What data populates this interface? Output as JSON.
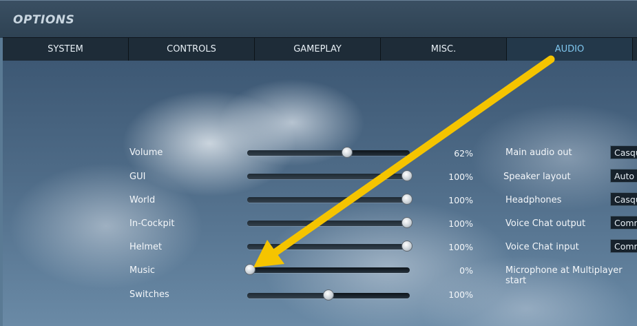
{
  "window": {
    "title": "OPTIONS"
  },
  "tabs": [
    {
      "label": "SYSTEM",
      "active": false
    },
    {
      "label": "CONTROLS",
      "active": false
    },
    {
      "label": "GAMEPLAY",
      "active": false
    },
    {
      "label": "MISC.",
      "active": false
    },
    {
      "label": "AUDIO",
      "active": true
    }
  ],
  "sliders": [
    {
      "label": "Volume",
      "value": 62,
      "display": "62%"
    },
    {
      "label": "GUI",
      "value": 100,
      "display": "100%"
    },
    {
      "label": "World",
      "value": 100,
      "display": "100%"
    },
    {
      "label": "In-Cockpit",
      "value": 100,
      "display": "100%"
    },
    {
      "label": "Helmet",
      "value": 100,
      "display": "100%"
    },
    {
      "label": "Music",
      "value": 0,
      "display": "0%"
    },
    {
      "label": "Switches",
      "value": 50,
      "display": "100%"
    }
  ],
  "devices": [
    {
      "label": "Main audio out",
      "value": "Casqu"
    },
    {
      "label": "Speaker layout",
      "value": "Auto"
    },
    {
      "label": "Headphones",
      "value": "Casqu"
    },
    {
      "label": "Voice Chat output",
      "value": "Comm"
    },
    {
      "label": "Voice Chat input",
      "value": "Comm"
    },
    {
      "label": "Microphone at Multiplayer start",
      "value": ""
    }
  ],
  "annotation": {
    "color": "#f5c400"
  }
}
